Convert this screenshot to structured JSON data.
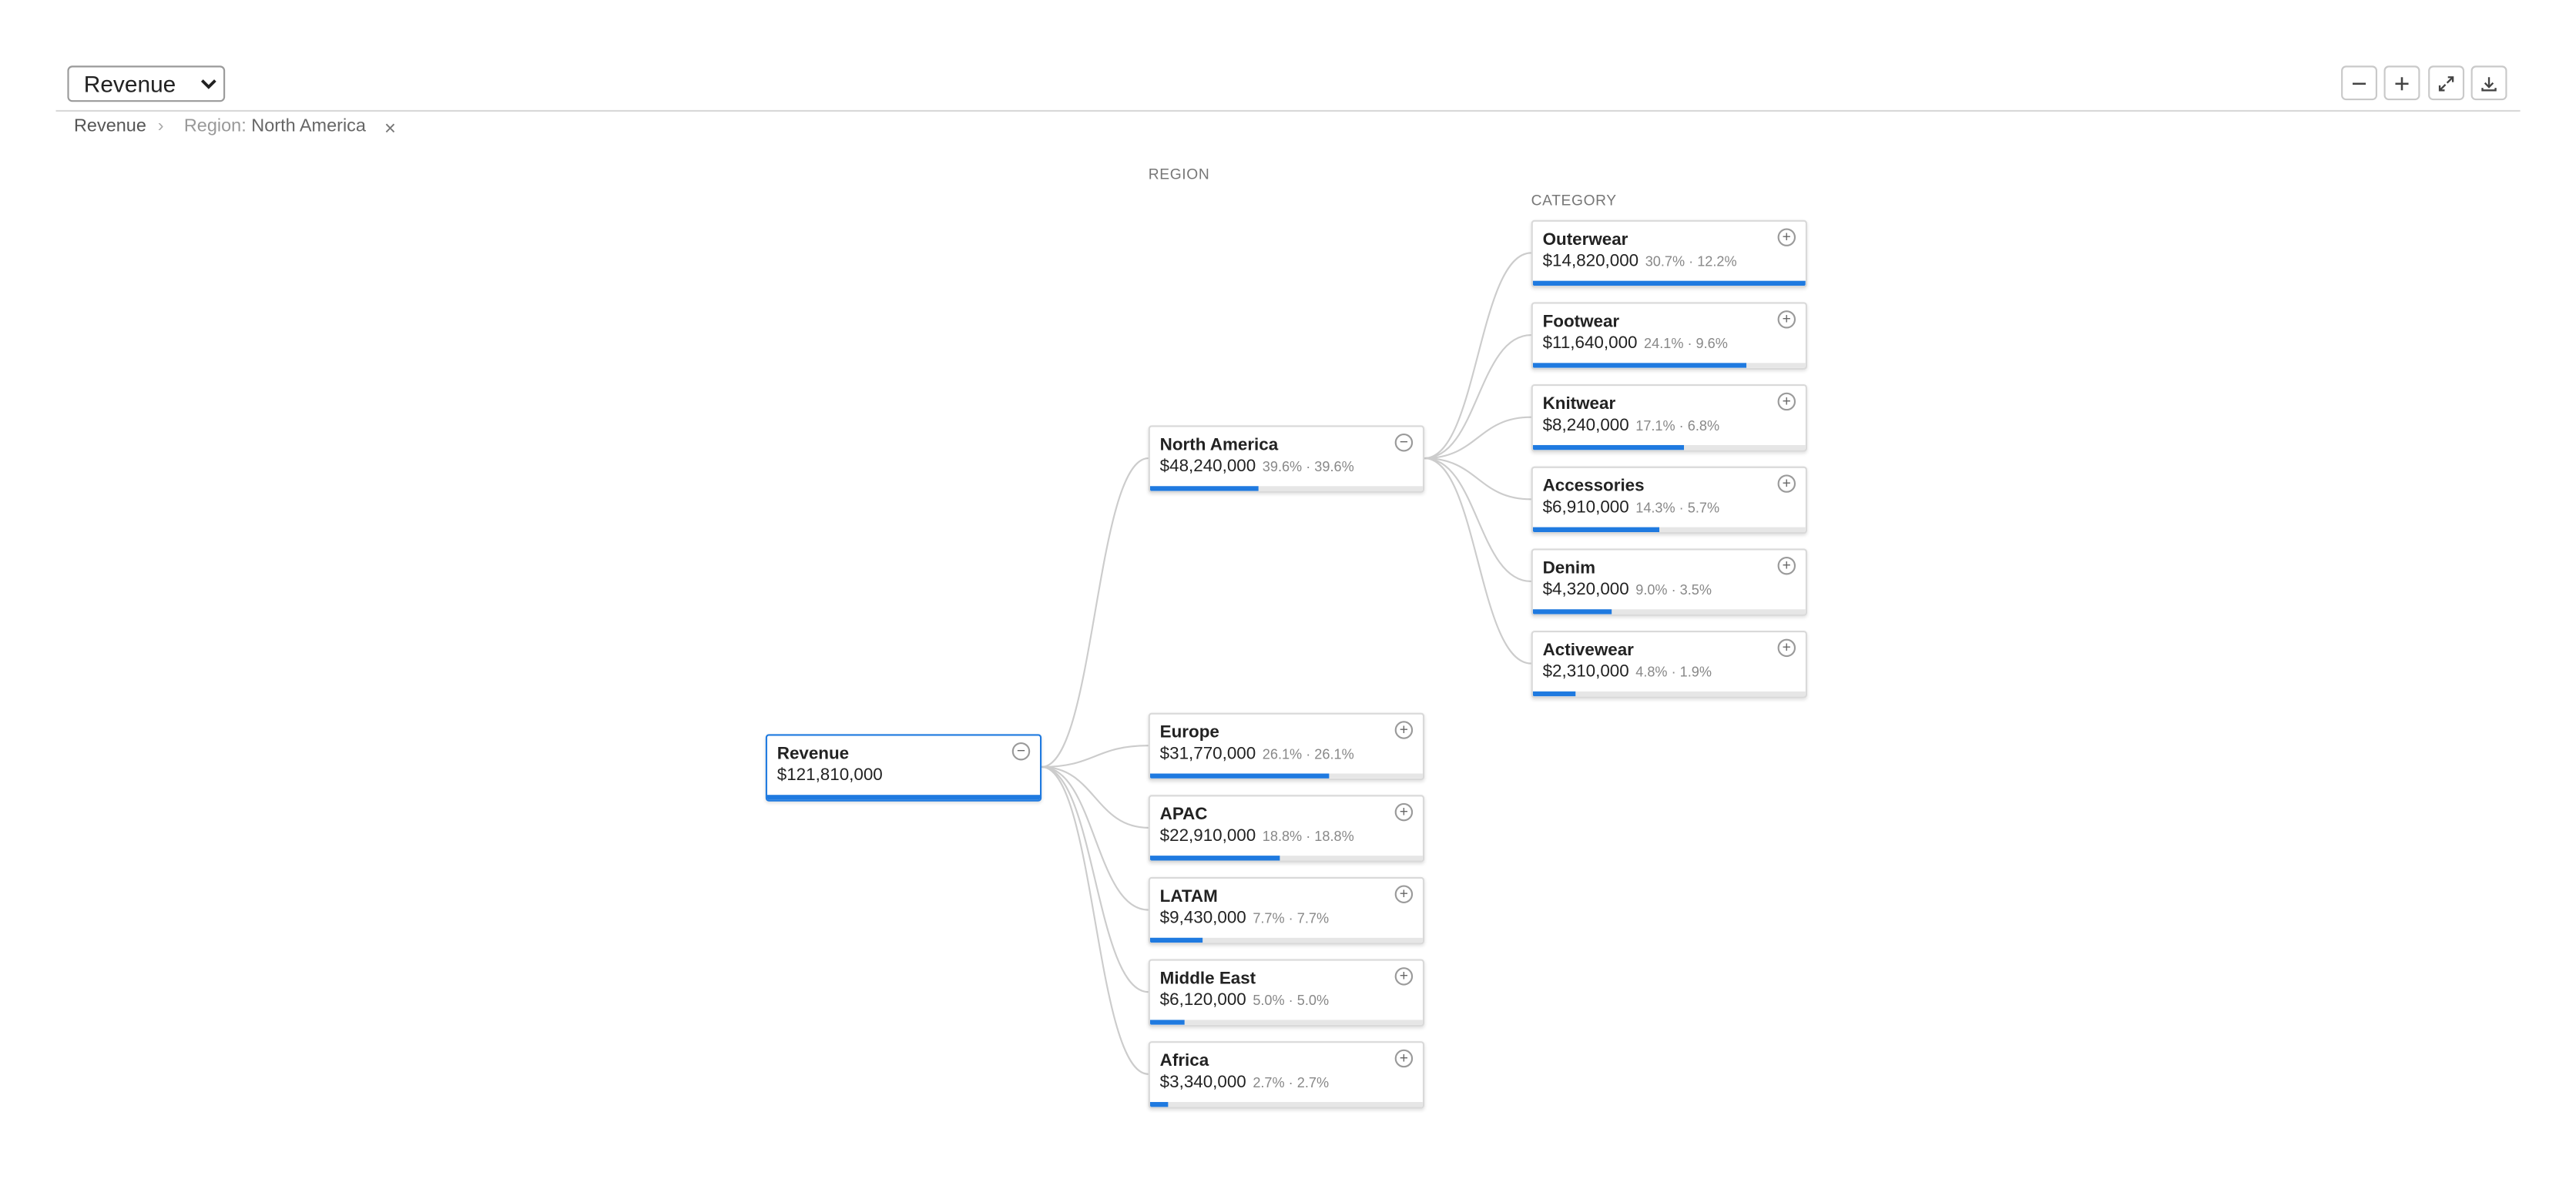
{
  "toolbar": {
    "measure_select": "Revenue",
    "zoom_out": "minus-icon",
    "zoom_in": "plus-icon",
    "fit": "expand-icon",
    "export": "download-icon"
  },
  "breadcrumb": {
    "root": "Revenue",
    "filter_key": "Region:",
    "filter_value": "North America"
  },
  "levels": {
    "region": "REGION",
    "category": "CATEGORY"
  },
  "colors": {
    "accent": "#1f7ae0",
    "track": "#e6e6e6",
    "link": "#cccccc"
  },
  "root": {
    "name": "Revenue",
    "value": "$121,810,000",
    "share": 1.0,
    "toggle": "−"
  },
  "regions": [
    {
      "name": "North America",
      "value": "$48,240,000",
      "pct": "39.6% · 39.6%",
      "share": 0.396,
      "toggle": "−"
    },
    {
      "name": "Europe",
      "value": "$31,770,000",
      "pct": "26.1% · 26.1%",
      "share": 0.659,
      "toggle": "+"
    },
    {
      "name": "APAC",
      "value": "$22,910,000",
      "pct": "18.8% · 18.8%",
      "share": 0.475,
      "toggle": "+"
    },
    {
      "name": "LATAM",
      "value": "$9,430,000",
      "pct": "7.7% · 7.7%",
      "share": 0.195,
      "toggle": "+"
    },
    {
      "name": "Middle East",
      "value": "$6,120,000",
      "pct": "5.0% · 5.0%",
      "share": 0.127,
      "toggle": "+"
    },
    {
      "name": "Africa",
      "value": "$3,340,000",
      "pct": "2.7% · 2.7%",
      "share": 0.069,
      "toggle": "+"
    }
  ],
  "categories": [
    {
      "name": "Outerwear",
      "value": "$14,820,000",
      "pct": "30.7% · 12.2%",
      "share": 1.0,
      "toggle": "+"
    },
    {
      "name": "Footwear",
      "value": "$11,640,000",
      "pct": "24.1% · 9.6%",
      "share": 0.785,
      "toggle": "+"
    },
    {
      "name": "Knitwear",
      "value": "$8,240,000",
      "pct": "17.1% · 6.8%",
      "share": 0.556,
      "toggle": "+"
    },
    {
      "name": "Accessories",
      "value": "$6,910,000",
      "pct": "14.3% · 5.7%",
      "share": 0.466,
      "toggle": "+"
    },
    {
      "name": "Denim",
      "value": "$4,320,000",
      "pct": "9.0% · 3.5%",
      "share": 0.292,
      "toggle": "+"
    },
    {
      "name": "Activewear",
      "value": "$2,310,000",
      "pct": "4.8% · 1.9%",
      "share": 0.156,
      "toggle": "+"
    }
  ]
}
